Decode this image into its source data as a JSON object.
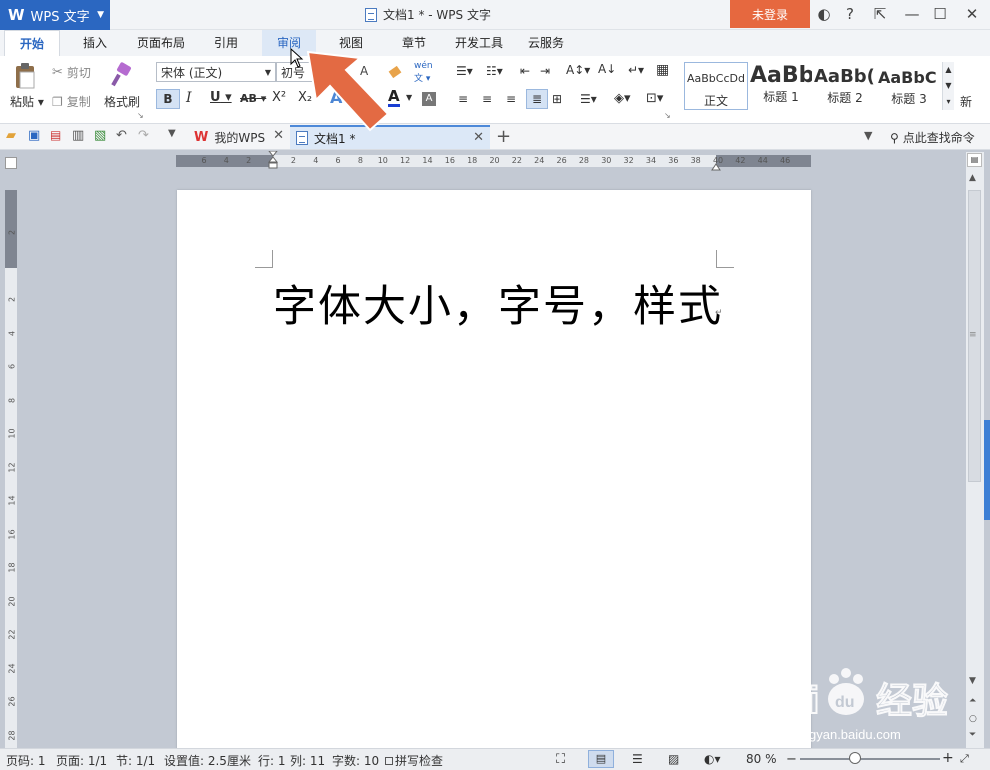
{
  "app": {
    "logo_text": "WPS 文字",
    "window_title": "文档1 * - WPS 文字",
    "login_label": "未登录"
  },
  "tabs": [
    "开始",
    "插入",
    "页面布局",
    "引用",
    "审阅",
    "视图",
    "章节",
    "开发工具",
    "云服务"
  ],
  "ribbon": {
    "paste": "粘贴",
    "cut": "剪切",
    "copy": "复制",
    "format_painter": "格式刷",
    "font_name": "宋体 (正文)",
    "font_size": "初号",
    "bold": "B",
    "italic": "I",
    "underline": "U",
    "strike": "AB",
    "superscript": "X²",
    "subscript": "X₂",
    "styles": [
      {
        "preview": "AaBbCcDd",
        "name": "正文"
      },
      {
        "preview": "AaBb",
        "name": "标题 1"
      },
      {
        "preview": "AaBb(",
        "name": "标题 2"
      },
      {
        "preview": "AaBbC",
        "name": "标题 3"
      }
    ],
    "new_style": "新"
  },
  "doc_tabs": {
    "home": "我的WPS",
    "current": "文档1 *",
    "search_cmd": "点此查找命令"
  },
  "ruler_h": [
    "6",
    "4",
    "2",
    "",
    "2",
    "4",
    "6",
    "8",
    "10",
    "12",
    "14",
    "16",
    "18",
    "20",
    "22",
    "24",
    "26",
    "28",
    "30",
    "32",
    "34",
    "36",
    "38",
    "40",
    "42",
    "44",
    "46"
  ],
  "ruler_v": [
    "2",
    "",
    "2",
    "4",
    "6",
    "8",
    "10",
    "12",
    "14",
    "16",
    "18",
    "20",
    "22",
    "24",
    "26",
    "28"
  ],
  "document": {
    "text": "字体大小，字号，样式",
    "para_mark": "↵"
  },
  "status": {
    "page_code": "页码: 1",
    "pages": "页面: 1/1",
    "section": "节: 1/1",
    "setting": "设置值: 2.5厘米",
    "line": "行: 1",
    "column": "列: 11",
    "word_count": "字数: 10",
    "spell_check": "拼写检查",
    "zoom": "80 %"
  },
  "watermark": {
    "brand": "Bai",
    "brand2": "du",
    "cn": "经验",
    "url": "jingyan.baidu.com"
  },
  "colors": {
    "accent": "#2b67c1",
    "login": "#e6683f",
    "arrow": "#e36a43"
  }
}
